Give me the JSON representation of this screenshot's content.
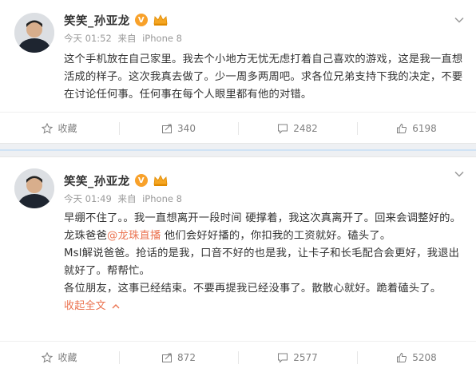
{
  "posts": [
    {
      "author": "笑笑_孙亚龙",
      "verified_badge": "V",
      "time": "今天 01:52",
      "source_prefix": "来自",
      "source": "iPhone 8",
      "paragraphs": [
        "这个手机放在自己家里。我去个小地方无忧无虑打着自己喜欢的游戏，这是我一直想活成的样子。这次我真去做了。少一周多两周吧。求各位兄弟支持下我的决定，不要在讨论任何事。任何事在每个人眼里都有他的对错。"
      ],
      "actions": {
        "favorite": "收藏",
        "repost": "340",
        "comment": "2482",
        "like": "6198"
      }
    },
    {
      "author": "笑笑_孙亚龙",
      "verified_badge": "V",
      "time": "今天 01:49",
      "source_prefix": "来自",
      "source": "iPhone 8",
      "p1": "早绷不住了。。我一直想离开一段时间 硬撑着，我这次真离开了。回来会调整好的。",
      "p2_prefix": "龙珠爸爸",
      "p2_mention": "@龙珠直播",
      "p2_suffix": " 他们会好好播的，你扣我的工资就好。磕头了。",
      "p3": "Msl解说爸爸。抢话的是我，口音不好的也是我，让卡子和长毛配合会更好，我退出就好了。帮帮忙。",
      "p4": "各位朋友，这事已经结束。不要再提我已经没事了。散散心就好。跪着磕头了。",
      "collapse_label": "收起全文",
      "actions": {
        "favorite": "收藏",
        "repost": "872",
        "comment": "2577",
        "like": "5208"
      }
    }
  ],
  "colors": {
    "accent": "#eb7350",
    "meta": "#999999",
    "verified": "#f8a12a"
  },
  "icons": [
    "chevron-down-icon",
    "star-icon",
    "repost-icon",
    "comment-icon",
    "like-icon",
    "chevron-up-icon",
    "verified-icon",
    "crown-icon"
  ]
}
